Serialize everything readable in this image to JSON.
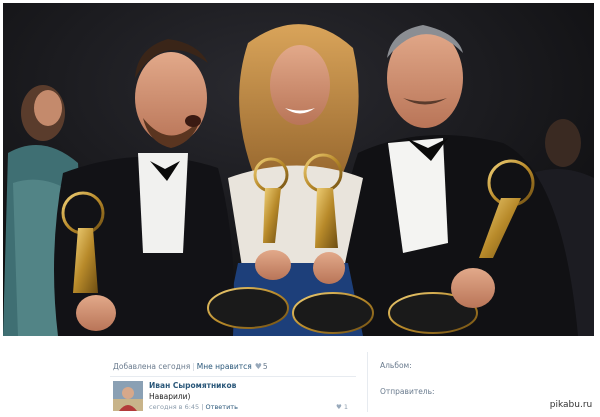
{
  "post": {
    "added_text": "Добавлена сегодня",
    "like_label": "Мне нравится",
    "like_count": "5"
  },
  "comment": {
    "author": "Иван Сыромятников",
    "text": "Наварили)",
    "time": "сегодня в 6:45",
    "reply_label": "Ответить",
    "like_count": "1"
  },
  "sidebar": {
    "album_label": "Альбом:",
    "sender_label": "Отправитель:"
  },
  "watermark": "pikabu.ru",
  "colors": {
    "link": "#2b587a",
    "meta": "#6a7b8e",
    "photo_bg": "#0e0e10"
  }
}
